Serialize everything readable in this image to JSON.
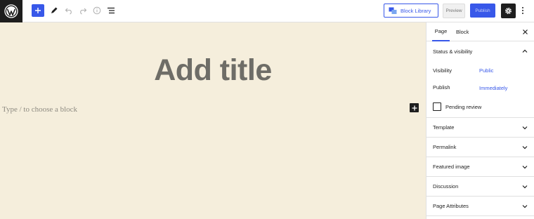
{
  "toolbar": {
    "block_library_label": "Block Library",
    "preview_label": "Preview",
    "publish_label": "Publish",
    "accent_color": "#3858e9"
  },
  "editor": {
    "title_placeholder": "Add title",
    "block_placeholder": "Type / to choose a block",
    "background_color": "#f5eedc"
  },
  "sidebar": {
    "tabs": [
      {
        "label": "Page",
        "active": true
      },
      {
        "label": "Block",
        "active": false
      }
    ],
    "status_panel": {
      "title": "Status & visibility",
      "visibility_label": "Visibility",
      "visibility_value": "Public",
      "publish_label": "Publish",
      "publish_value": "Immediately",
      "pending_review_label": "Pending review",
      "pending_review_checked": false
    },
    "panels": [
      {
        "label": "Template"
      },
      {
        "label": "Permalink"
      },
      {
        "label": "Featured image"
      },
      {
        "label": "Discussion"
      },
      {
        "label": "Page Attributes"
      }
    ]
  }
}
